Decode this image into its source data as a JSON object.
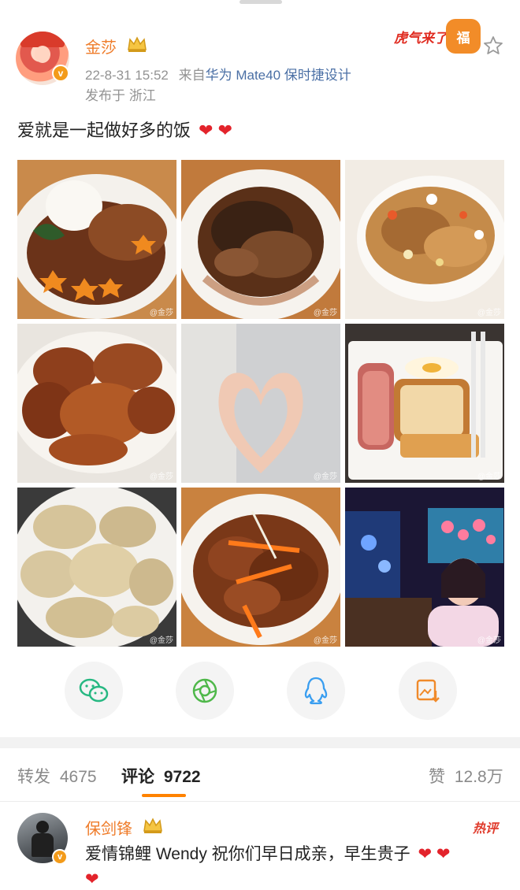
{
  "post": {
    "username": "金莎",
    "timestamp": "22-8-31 15:52",
    "source_prefix": "来自",
    "device": "华为 Mate40 保时捷设计",
    "location": "发布于 浙江",
    "text": "爱就是一起做好多的饭",
    "hearts": "❤ ❤",
    "tiger_badge_text": "虎气来了",
    "tiger_badge_glyph": "福",
    "verified_mark": "v"
  },
  "photos": [
    {
      "name": "dish-rice-with-pork-chop"
    },
    {
      "name": "dish-braised-eggplant"
    },
    {
      "name": "dish-fried-rice"
    },
    {
      "name": "dish-fried-chicken"
    },
    {
      "name": "hands-heart"
    },
    {
      "name": "toast-bacon-egg-breakfast"
    },
    {
      "name": "dish-crispy-tofu"
    },
    {
      "name": "dish-sweet-sour-pork"
    },
    {
      "name": "aquarium-selfie"
    }
  ],
  "watermark": "@金莎",
  "share": [
    "wechat-icon",
    "moments-icon",
    "qq-icon",
    "save-image-icon"
  ],
  "tabs": {
    "repost_label": "转发",
    "repost_count": "4675",
    "comment_label": "评论",
    "comment_count": "9722",
    "like_label": "赞",
    "like_count": "12.8万"
  },
  "comment": {
    "username": "保剑锋",
    "badge": "热评",
    "text": "爱情锦鲤 Wendy 祝你们早日成亲，早生贵子",
    "hearts": "❤ ❤",
    "trailing_heart": "❤",
    "verified_mark": "v"
  },
  "colors": {
    "accent_orange": "#ff8200",
    "username_orange": "#ef7c2a",
    "link_blue": "#4a6fa5",
    "heart_red": "#e3232b"
  }
}
